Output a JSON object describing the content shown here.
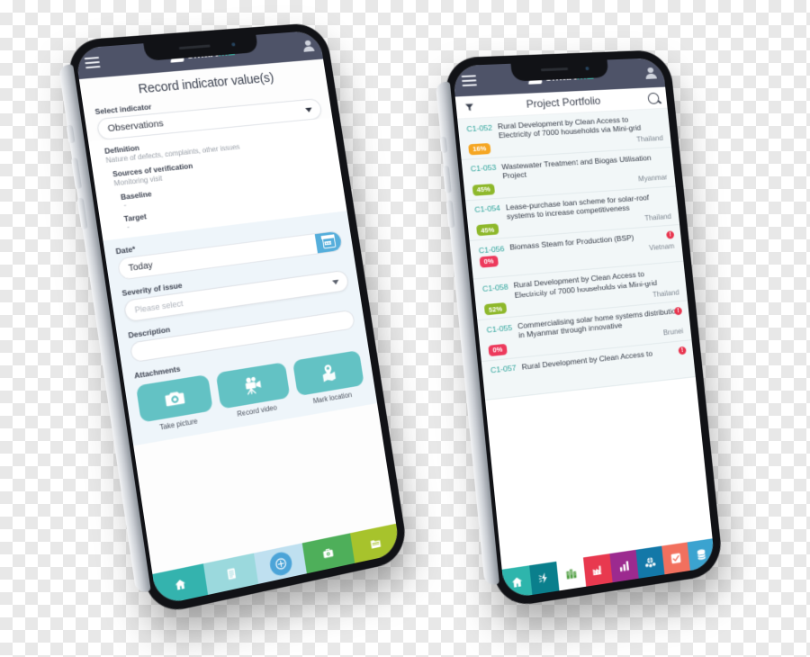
{
  "brand": {
    "name_light": "smart",
    "name_accent": "ME",
    "logo_icon": "stacked-layers-icon"
  },
  "phone1": {
    "appbar": {
      "menu_icon": "hamburger-menu-icon",
      "avatar_icon": "user-avatar-icon"
    },
    "page_title": "Record indicator value(s)",
    "select_indicator": {
      "label": "Select indicator",
      "value": "Observations",
      "caret_icon": "chevron-down-icon"
    },
    "meta": {
      "definition_label": "Definition",
      "definition_text": "Nature of defects, complaints, other issues",
      "sources_label": "Sources of verification",
      "sources_text": "Monitoring visit",
      "baseline_label": "Baseline",
      "baseline_value": "-",
      "target_label": "Target",
      "target_value": "-"
    },
    "date": {
      "label": "Date*",
      "value": "Today",
      "calendar_icon": "calendar-icon"
    },
    "severity": {
      "label": "Severity of issue",
      "placeholder": "Please select",
      "caret_icon": "chevron-down-icon"
    },
    "description": {
      "label": "Description",
      "value": ""
    },
    "attachments": {
      "label": "Attachments",
      "items": [
        {
          "caption": "Take picture",
          "icon": "camera-icon",
          "color": "#63c2c4"
        },
        {
          "caption": "Record video",
          "icon": "video-camera-icon",
          "color": "#63c2c4"
        },
        {
          "caption": "Mark location",
          "icon": "map-pin-icon",
          "color": "#63c2c4"
        }
      ]
    },
    "tabbar": [
      {
        "icon": "home-icon",
        "color": "#34b3ae"
      },
      {
        "icon": "document-list-icon",
        "color": "#9bd9dd"
      },
      {
        "icon": "add-circle-icon",
        "color": "#bfe0f0",
        "fab_color": "#4ba4d8",
        "active": true
      },
      {
        "icon": "briefcase-camera-icon",
        "color": "#4eaf5a"
      },
      {
        "icon": "folder-icon",
        "color": "#a7c32c"
      }
    ]
  },
  "phone2": {
    "appbar": {
      "menu_icon": "hamburger-menu-icon",
      "avatar_icon": "user-avatar-icon"
    },
    "list_header": {
      "filter_icon": "funnel-filter-icon",
      "title": "Project Portfolio",
      "search_icon": "search-icon"
    },
    "projects": [
      {
        "code": "C1-052",
        "title": "Rural Development by Clean Access to Electricity of 7000 households via Mini-grid",
        "progress": "16%",
        "badge_color": "#f5a623",
        "country": "Thailand",
        "alert": false
      },
      {
        "code": "C1-053",
        "title": "Wastewater Treatment and Biogas Utilisation Project",
        "progress": "45%",
        "badge_color": "#8eb82b",
        "country": "Myanmar",
        "alert": false
      },
      {
        "code": "C1-054",
        "title": "Lease-purchase loan scheme for solar-roof systems to increase competitiveness",
        "progress": "45%",
        "badge_color": "#8eb82b",
        "country": "Thailand",
        "alert": false
      },
      {
        "code": "C1-056",
        "title": "Biomass Steam for Production (BSP)",
        "progress": "0%",
        "badge_color": "#ed3a5c",
        "country": "Vietnam",
        "alert": true,
        "alert_glyph": "!"
      },
      {
        "code": "C1-058",
        "title": "Rural Development by Clean Access to Electricity of 7000 households via Mini-grid",
        "progress": "52%",
        "badge_color": "#8eb82b",
        "country": "Thailand",
        "alert": false
      },
      {
        "code": "C1-055",
        "title": "Commercialising solar home systems distribution in Myanmar through innovative",
        "progress": "0%",
        "badge_color": "#ed3a5c",
        "country": "Brunei",
        "alert": true,
        "alert_glyph": "!"
      },
      {
        "code": "C1-057",
        "title": "Rural Development by Clean Access to",
        "progress": "",
        "badge_color": "",
        "country": "",
        "alert": true,
        "alert_glyph": "!"
      }
    ],
    "tabbar": [
      {
        "icon": "home-icon",
        "color": "#2eb5ac"
      },
      {
        "icon": "plug-power-icon",
        "color": "#0a7f8c"
      },
      {
        "icon": "building-icon",
        "color": "#ffffff"
      },
      {
        "icon": "factory-icon",
        "color": "#e8394f"
      },
      {
        "icon": "bar-chart-icon",
        "color": "#9c2a8f"
      },
      {
        "icon": "people-globe-icon",
        "color": "#1378a8"
      },
      {
        "icon": "checklist-icon",
        "color": "#f2705e"
      },
      {
        "icon": "database-icon",
        "color": "#3ba3d0"
      }
    ]
  }
}
